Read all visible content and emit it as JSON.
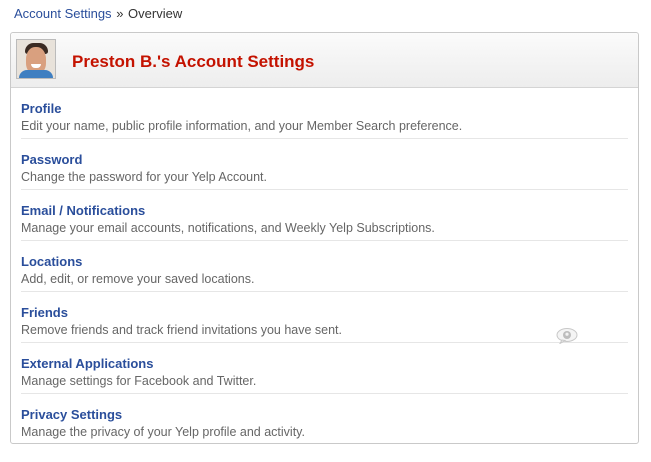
{
  "breadcrumb": {
    "link": "Account Settings",
    "separator": "»",
    "current": "Overview"
  },
  "header": {
    "title": "Preston B.'s Account Settings"
  },
  "settings": [
    {
      "title": "Profile",
      "description": "Edit your name, public profile information, and your Member Search preference."
    },
    {
      "title": "Password",
      "description": "Change the password for your Yelp Account."
    },
    {
      "title": "Email / Notifications",
      "description": "Manage your email accounts, notifications, and Weekly Yelp Subscriptions."
    },
    {
      "title": "Locations",
      "description": "Add, edit, or remove your saved locations."
    },
    {
      "title": "Friends",
      "description": "Remove friends and track friend invitations you have sent."
    },
    {
      "title": "External Applications",
      "description": "Manage settings for Facebook and Twitter."
    },
    {
      "title": "Privacy Settings",
      "description": "Manage the privacy of your Yelp profile and activity."
    }
  ],
  "colors": {
    "link": "#2a4e9b",
    "title": "#c41200",
    "description": "#666666"
  },
  "icons": {
    "avatar": "user-avatar",
    "chat": "chat-bubble-icon"
  }
}
